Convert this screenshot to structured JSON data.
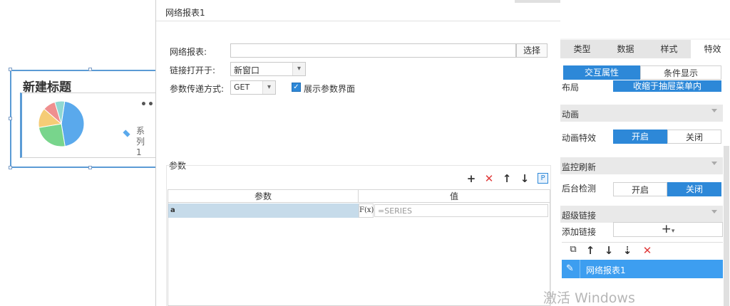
{
  "widget": {
    "title": "新建标题",
    "more_icon": "more-dots-icon",
    "legend_label": "系列1"
  },
  "chart_data": {
    "type": "pie",
    "categories": [
      "",
      "",
      "",
      "",
      ""
    ],
    "values": [
      45,
      25,
      14,
      9,
      7
    ],
    "colors": [
      "#5aa9ec",
      "#78d58c",
      "#f5cc76",
      "#ef8f8f",
      "#8fd8d2"
    ],
    "legend": [
      "系列1"
    ],
    "legend_placement": "right"
  },
  "dialog": {
    "title": "网络报表1",
    "report_label": "网络报表:",
    "report_value": "",
    "select_button": "选择",
    "open_in_label": "链接打开于:",
    "open_in_value": "新窗口",
    "method_label": "参数传递方式:",
    "method_value": "GET",
    "show_params_label": "展示参数界面",
    "show_params_checked": true,
    "params_section_label": "参数",
    "table": {
      "columns": [
        "参数",
        "值"
      ],
      "rows": [
        {
          "param": "a",
          "value_placeholder": "=SERIES",
          "formula_icon": "F(x)"
        }
      ]
    }
  },
  "right_panel": {
    "tabs": [
      "类型",
      "数据",
      "样式",
      "特效"
    ],
    "active_tab": "特效",
    "subtabs": [
      "交互属性",
      "条件显示"
    ],
    "layout_label": "布局",
    "layout_value": "收缩于抽屉菜单内",
    "animation_header": "动画",
    "animation_effect_label": "动画特效",
    "animation_on": "开启",
    "animation_off": "关闭",
    "monitor_header": "监控刷新",
    "background_check_label": "后台检测",
    "monitor_on": "开启",
    "monitor_off": "关闭",
    "hyperlink_header": "超级链接",
    "add_link_label": "添加链接",
    "add_link_button": "+",
    "link_item": "网络报表1",
    "accent_color": "#2d88d8"
  },
  "watermark": "激活 Windows"
}
